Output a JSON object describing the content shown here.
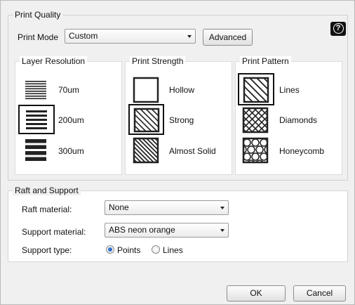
{
  "print_quality": {
    "legend": "Print Quality",
    "print_mode_label": "Print Mode",
    "print_mode_value": "Custom",
    "advanced_button": "Advanced",
    "help_symbol": "?",
    "layer_resolution": {
      "legend": "Layer Resolution",
      "options": [
        "70um",
        "200um",
        "300um"
      ],
      "selected": "200um"
    },
    "print_strength": {
      "legend": "Print Strength",
      "options": [
        "Hollow",
        "Strong",
        "Almost Solid"
      ],
      "selected": "Strong"
    },
    "print_pattern": {
      "legend": "Print Pattern",
      "options": [
        "Lines",
        "Diamonds",
        "Honeycomb"
      ],
      "selected": "Lines"
    }
  },
  "raft_support": {
    "legend": "Raft and Support",
    "raft_material_label": "Raft material:",
    "raft_material_value": "None",
    "support_material_label": "Support material:",
    "support_material_value": "ABS neon orange",
    "support_type_label": "Support type:",
    "support_type_options": [
      "Points",
      "Lines"
    ],
    "support_type_selected": "Points"
  },
  "footer": {
    "ok_button": "OK",
    "cancel_button": "Cancel"
  },
  "icons": {
    "help": "help-icon",
    "dropdown": "chevron-down-icon"
  }
}
